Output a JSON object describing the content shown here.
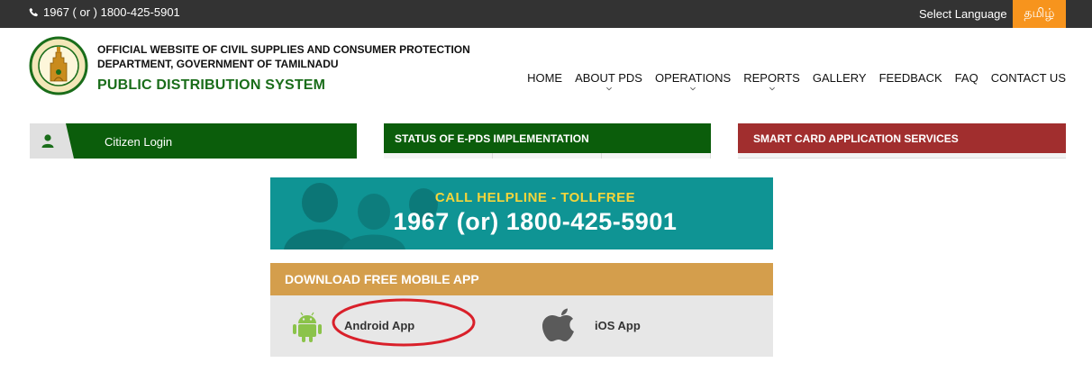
{
  "topbar": {
    "phone": "1967 ( or ) 1800-425-5901",
    "select_language": "Select Language",
    "tamil": "தமிழ்"
  },
  "header": {
    "dept_line1": "OFFICIAL WEBSITE OF CIVIL SUPPLIES AND CONSUMER PROTECTION",
    "dept_line2": "DEPARTMENT, GOVERNMENT OF TAMILNADU",
    "system_name": "PUBLIC DISTRIBUTION SYSTEM"
  },
  "nav": {
    "home": "HOME",
    "about": "ABOUT PDS",
    "operations": "OPERATIONS",
    "reports": "REPORTS",
    "gallery": "GALLERY",
    "feedback": "FEEDBACK",
    "faq": "FAQ",
    "contact": "CONTACT US"
  },
  "panels": {
    "citizen_login": "Citizen Login",
    "status_epds": "STATUS OF E-PDS IMPLEMENTATION",
    "smart_card": "SMART CARD APPLICATION SERVICES"
  },
  "helpline": {
    "title": "CALL HELPLINE - TOLLFREE",
    "number": "1967 (or) 1800-425-5901"
  },
  "mobile_app": {
    "heading": "DOWNLOAD FREE MOBILE APP",
    "android": "Android App",
    "ios": "iOS App"
  },
  "colors": {
    "topbar": "#333333",
    "accent_orange": "#f7941d",
    "green": "#0b5d0b",
    "red": "#a12e2e",
    "teal": "#0f9494",
    "gold": "#d49e4c",
    "annotation_red": "#d9202a"
  },
  "icons": [
    "phone-icon",
    "emblem-logo",
    "chevron-down-icon",
    "user-icon",
    "android-icon",
    "apple-icon"
  ]
}
